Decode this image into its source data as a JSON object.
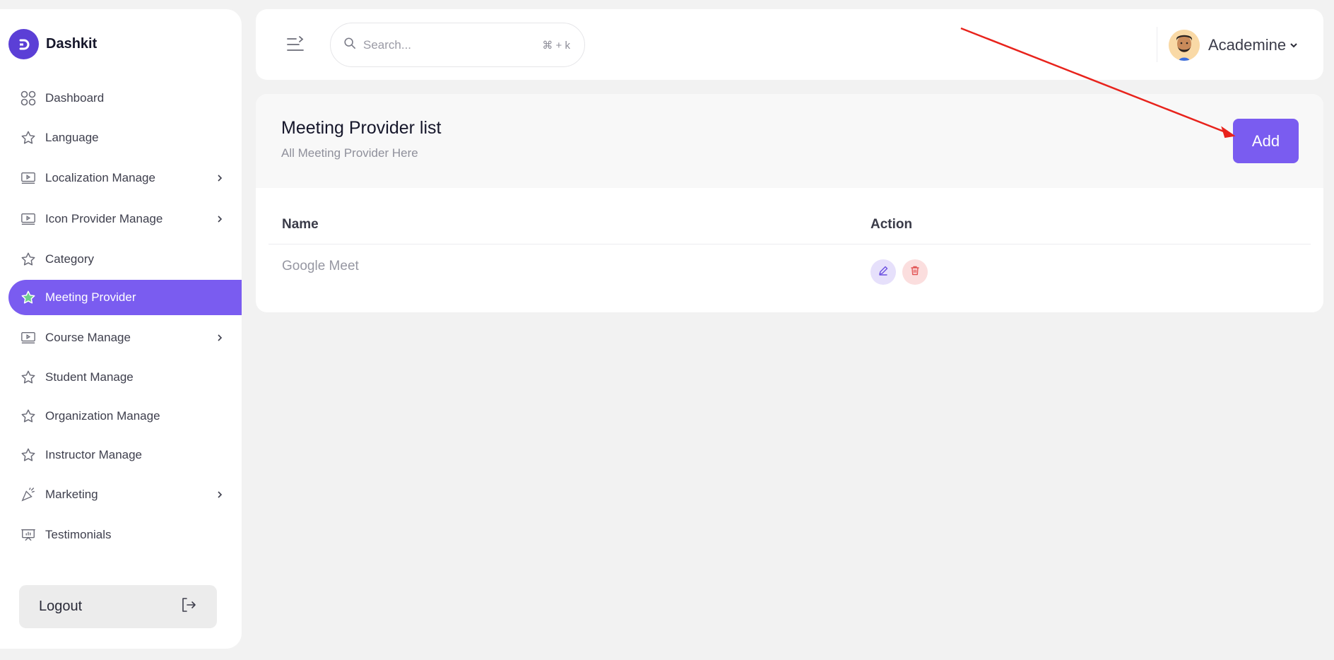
{
  "brand": {
    "name": "Dashkit"
  },
  "sidebar": {
    "items": [
      {
        "label": "Dashboard",
        "icon": "grid-icon",
        "has_submenu": false,
        "active": false
      },
      {
        "label": "Language",
        "icon": "star-icon",
        "has_submenu": false,
        "active": false
      },
      {
        "label": "Localization Manage",
        "icon": "video-icon",
        "has_submenu": true,
        "active": false
      },
      {
        "label": "Icon Provider Manage",
        "icon": "video-icon",
        "has_submenu": true,
        "active": false
      },
      {
        "label": "Category",
        "icon": "star-icon",
        "has_submenu": false,
        "active": false
      },
      {
        "label": "Meeting Provider",
        "icon": "star-icon",
        "has_submenu": false,
        "active": true
      },
      {
        "label": "Course Manage",
        "icon": "video-icon",
        "has_submenu": true,
        "active": false
      },
      {
        "label": "Student Manage",
        "icon": "star-icon",
        "has_submenu": false,
        "active": false
      },
      {
        "label": "Organization Manage",
        "icon": "star-icon",
        "has_submenu": false,
        "active": false
      },
      {
        "label": "Instructor Manage",
        "icon": "star-icon",
        "has_submenu": false,
        "active": false
      },
      {
        "label": "Marketing",
        "icon": "megaphone-icon",
        "has_submenu": true,
        "active": false
      },
      {
        "label": "Testimonials",
        "icon": "presentation-icon",
        "has_submenu": false,
        "active": false
      }
    ],
    "logout_label": "Logout"
  },
  "search": {
    "placeholder": "Search...",
    "shortcut": "⌘ + k"
  },
  "user": {
    "name": "Academine"
  },
  "page": {
    "title": "Meeting Provider list",
    "subtitle": "All Meeting Provider Here",
    "add_label": "Add"
  },
  "table": {
    "columns": [
      "Name",
      "Action"
    ],
    "rows": [
      {
        "name": "Google Meet"
      }
    ]
  },
  "colors": {
    "accent": "#7a5cf0",
    "brand": "#5b3fd6",
    "delete": "#e25555",
    "annotation": "#e8231c"
  }
}
